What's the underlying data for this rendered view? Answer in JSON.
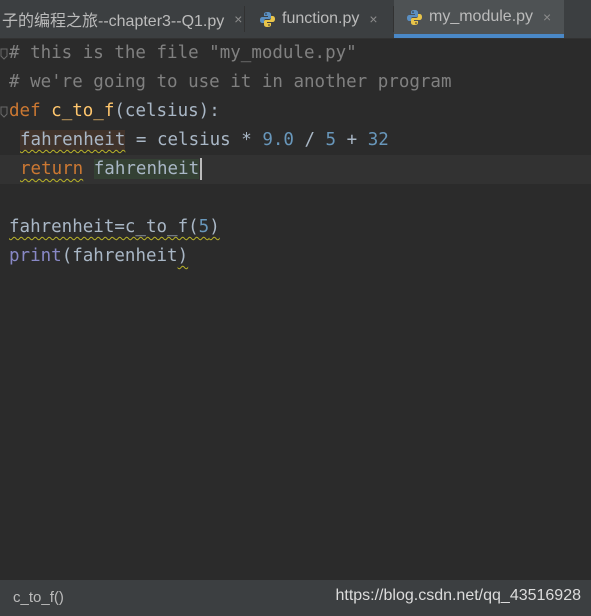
{
  "tabs": [
    {
      "label": "子的编程之旅--chapter3--Q1.py",
      "active": false,
      "close": "×"
    },
    {
      "label": "function.py",
      "active": false,
      "close": "×"
    },
    {
      "label": "my_module.py",
      "active": true,
      "close": "×"
    }
  ],
  "code": {
    "line1": "# this is the file \"my_module.py\"",
    "line2": "# we're going to use it in another program",
    "def_kw": "def",
    "func_name": "c_to_f",
    "params": "(celsius):",
    "assign_var": "fahrenheit",
    "assign_op": " = celsius * ",
    "num1": "9.0",
    "div": " / ",
    "num2": "5",
    "plus": " + ",
    "num3": "32",
    "return_kw": "return",
    "return_val": "fahrenheit",
    "call_var": "fahrenheit",
    "call_expr": "=c_to_f(",
    "call_arg": "5",
    "call_close": ")",
    "print_fn": "print",
    "print_open": "(fahrenheit",
    "print_close": ")"
  },
  "statusbar": {
    "breadcrumb": "c_to_f()",
    "watermark": "https://blog.csdn.net/qq_43516928"
  },
  "colors": {
    "background": "#2b2b2b",
    "keyword": "#cc7832",
    "function": "#ffc66d",
    "number": "#6897bb",
    "comment": "#808080",
    "text": "#a9b7c6",
    "accent": "#4a88c7"
  },
  "icons": [
    "python-file-icon",
    "close-icon",
    "fold-icon"
  ]
}
